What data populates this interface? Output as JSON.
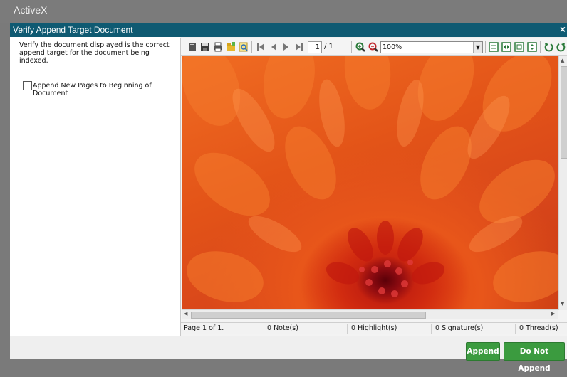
{
  "app": {
    "title": "ActiveX"
  },
  "dialog": {
    "title": "Verify Append Target Document",
    "close": "×",
    "instructions": "Verify the document displayed is the correct append target for the document being indexed.",
    "checkbox_label": "Append New Pages to Beginning of Document",
    "checkbox_checked": false
  },
  "viewer": {
    "toolbar": {
      "page_current": "1",
      "page_total": "/ 1",
      "zoom": "100%",
      "icons": [
        "document-icon",
        "save-icon",
        "print-icon",
        "open-folder-icon",
        "find-icon",
        "first-page-icon",
        "prev-page-icon",
        "next-page-icon",
        "last-page-icon",
        "zoom-in-icon",
        "zoom-out-icon",
        "fit-page-icon",
        "fit-width-icon",
        "actual-size-icon",
        "full-fit-icon",
        "rotate-left-icon",
        "rotate-right-icon"
      ]
    },
    "status": {
      "page": "Page 1 of 1.",
      "notes": "0 Note(s)",
      "highlights": "0 Highlight(s)",
      "signatures": "0 Signature(s)",
      "threads": "0 Thread(s)"
    },
    "image_subject": "orange-red chrysanthemum flower closeup"
  },
  "buttons": {
    "append": "Append",
    "do_not_append": "Do Not Append"
  },
  "colors": {
    "titlebar": "#0f5a72",
    "button_green": "#3b9b3f",
    "flower_orange": "#e8561a",
    "flower_center": "#8a0a10"
  }
}
